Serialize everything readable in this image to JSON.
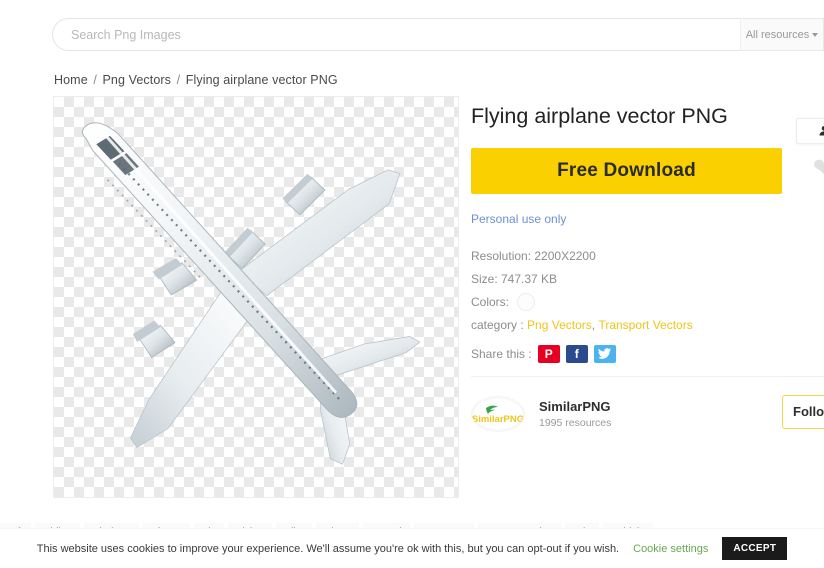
{
  "header": {
    "search": {
      "placeholder": "Search Png Images",
      "value": ""
    },
    "resource_filter": {
      "label": "All resources",
      "icon": "chevron-down-icon"
    }
  },
  "breadcrumb": {
    "home": "Home",
    "category": "Png Vectors",
    "current": "Flying airplane vector PNG",
    "separator": "/"
  },
  "preview": {
    "alt": "Flying airplane vector PNG",
    "background": "transparency-checkerboard"
  },
  "detail": {
    "title": "Flying airplane vector PNG",
    "download_button": "Free Download",
    "side_actions": {
      "download_count_icon": "download-person-icon",
      "favorite_icon": "heart-icon"
    },
    "license": "Personal use only",
    "resolution_label": "Resolution: 2200X2200",
    "size_label": "Size: 747.37 KB",
    "colors_label": "Colors:",
    "color_swatch": "#fdfdfd",
    "category_label": "category :",
    "categories": [
      "Png Vectors",
      "Transport Vectors"
    ],
    "category_separator": ",",
    "share_label": "Share this :",
    "share_icons": [
      {
        "name": "pinterest-icon",
        "glyph": "P",
        "color": "#e60023"
      },
      {
        "name": "facebook-icon",
        "glyph": "f",
        "color": "#2b4b8f"
      },
      {
        "name": "twitter-icon",
        "glyph": "ᴠ",
        "color": "#4bb3f0"
      }
    ],
    "author": {
      "name": "SimilarPNG",
      "resources": "1995 resources",
      "logo_text": "SimilarPNG",
      "follow_button": "Follow"
    }
  },
  "tags": [
    "Aircraft",
    "Airline",
    "Airplane",
    "Airport",
    "Fly",
    "Flying",
    "Pilot",
    "Plane",
    "Speed",
    "Transport",
    "Transportation",
    "Trip",
    "Vehicle"
  ],
  "cookie": {
    "text": "This website uses cookies to improve your experience. We'll assume you're ok with this, but you can opt-out if you wish.",
    "settings": "Cookie settings",
    "accept": "ACCEPT"
  },
  "colors": {
    "accent_yellow": "#fad000",
    "link_blue": "#6c8fd6",
    "category_yellow": "#f0c419",
    "cookie_green": "#6aa84f"
  }
}
